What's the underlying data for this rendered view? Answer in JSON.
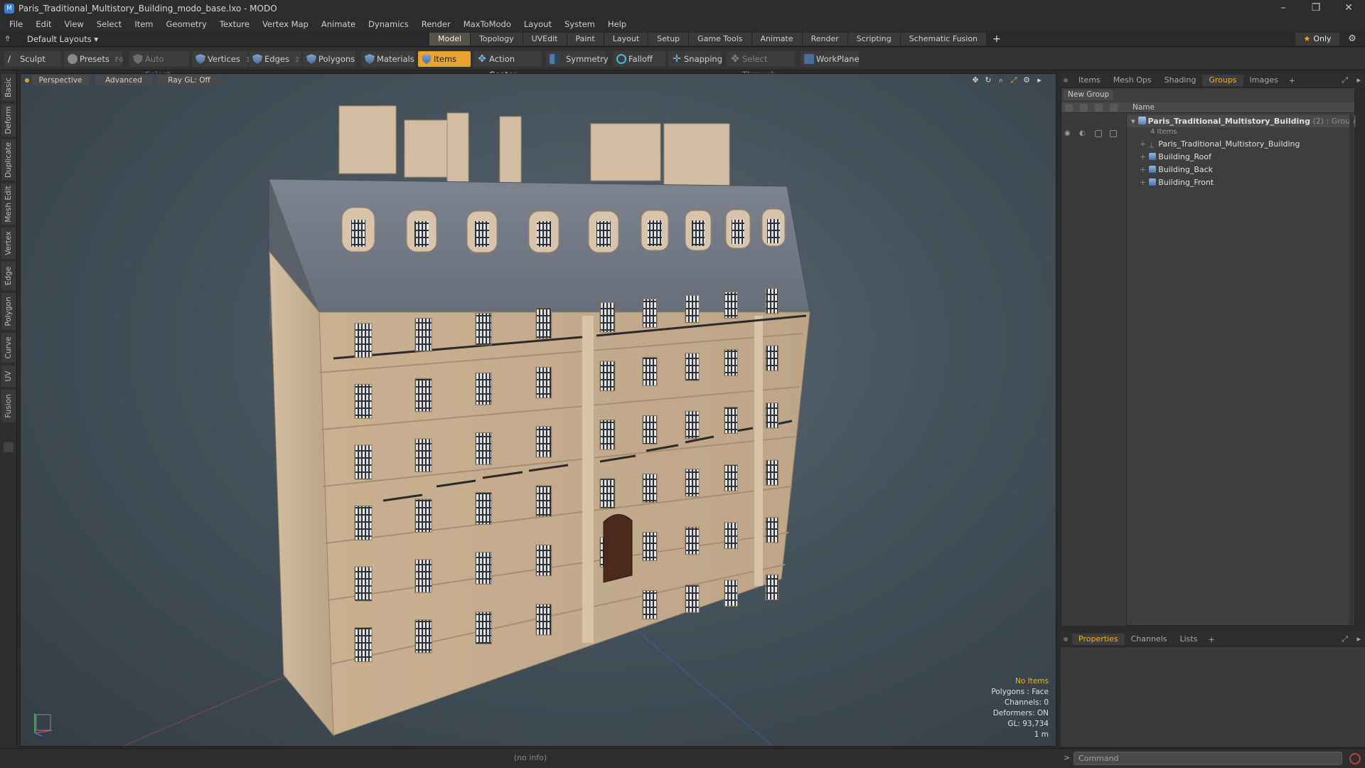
{
  "window": {
    "title": "Paris_Traditional_Multistory_Building_modo_base.lxo - MODO",
    "controls": [
      "–",
      "❐",
      "✕"
    ]
  },
  "menu": [
    "File",
    "Edit",
    "View",
    "Select",
    "Item",
    "Geometry",
    "Texture",
    "Vertex Map",
    "Animate",
    "Dynamics",
    "Render",
    "MaxToModo",
    "Layout",
    "System",
    "Help"
  ],
  "layout": {
    "selector": "Default Layouts ▾",
    "tabs": [
      "Model",
      "Topology",
      "UVEdit",
      "Paint",
      "Layout",
      "Setup",
      "Game Tools",
      "Animate",
      "Render",
      "Scripting",
      "Schematic Fusion"
    ],
    "active_tab": "Model",
    "add": "+",
    "only_label": "Only"
  },
  "toolbar": {
    "sculpt": "Sculpt",
    "presets": "Presets",
    "presets_key": "F6",
    "auto_select": "Auto Select",
    "vertices": "Vertices",
    "vertices_key": "1",
    "edges": "Edges",
    "edges_key": "2",
    "polygons": "Polygons",
    "materials": "Materials",
    "items": "Items",
    "action_center": "Action Center",
    "symmetry": "Symmetry",
    "falloff": "Falloff",
    "snapping": "Snapping",
    "select_through": "Select Through",
    "workplane": "WorkPlane"
  },
  "left_tabs": [
    "Basic",
    "Deform",
    "Duplicate",
    "Mesh Edit",
    "Vertex",
    "Edge",
    "Polygon",
    "Curve",
    "UV",
    "Fusion"
  ],
  "viewport": {
    "view": "Perspective",
    "shading": "Advanced",
    "raygl": "Ray GL: Off",
    "stats": {
      "items": "No Items",
      "polygons": "Polygons : Face",
      "channels": "Channels: 0",
      "deformers": "Deformers: ON",
      "gl": "GL: 93,734",
      "scale": "1 m"
    }
  },
  "right_panel": {
    "tabs": [
      "Items",
      "Mesh Ops",
      "Shading",
      "Groups",
      "Images"
    ],
    "active_tab": "Groups",
    "new_group": "New Group",
    "column_name": "Name",
    "tree": {
      "group_name": "Paris_Traditional_Multistory_Building",
      "group_count": "(2)",
      "group_type": ": Group",
      "group_sub": "4 Items",
      "children": [
        "Paris_Traditional_Multistory_Building",
        "Building_Roof",
        "Building_Back",
        "Building_Front"
      ]
    }
  },
  "properties_panel": {
    "tabs": [
      "Properties",
      "Channels",
      "Lists"
    ],
    "active_tab": "Properties"
  },
  "status": {
    "info": "(no info)",
    "command_placeholder": "Command",
    "prompt": ">"
  },
  "colors": {
    "accent": "#e8a42e",
    "facade": "#cdb497",
    "roof": "#6f7683",
    "viewport_bg": "#4f5c65"
  }
}
